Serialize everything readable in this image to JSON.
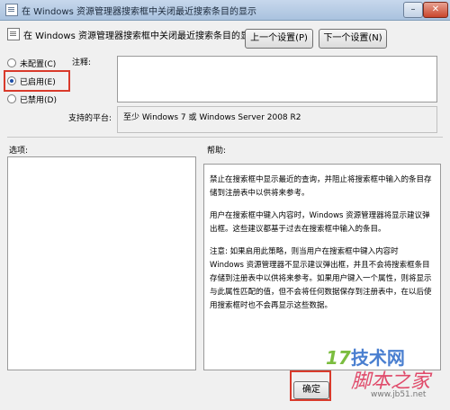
{
  "window": {
    "title": "在 Windows 资源管理器搜索框中关闭最近搜索条目的显示"
  },
  "setting": {
    "title": "在 Windows 资源管理器搜索框中关闭最近搜索条目的显示",
    "prev_label": "上一个设置(P)",
    "next_label": "下一个设置(N)"
  },
  "options": [
    {
      "label": "未配置(C)",
      "selected": false
    },
    {
      "label": "已启用(E)",
      "selected": true
    },
    {
      "label": "已禁用(D)",
      "selected": false
    }
  ],
  "comment_label": "注释:",
  "platform": {
    "label": "支持的平台:",
    "value": "至少 Windows 7 或 Windows Server 2008 R2"
  },
  "options_label": "选项:",
  "help_label": "帮助:",
  "help_paragraphs": [
    "禁止在搜索框中显示最近的查询，并阻止将搜索框中输入的条目存储到注册表中以供将来参考。",
    "用户在搜索框中键入内容时，Windows 资源管理器将显示建议弹出框。这些建议都基于过去在搜索框中输入的条目。",
    "注意: 如果启用此策略，则当用户在搜索框中键入内容时 Windows 资源管理器不显示建议弹出框，并且不会将搜索框条目存储到注册表中以供将来参考。如果用户键入一个属性，则将显示与此属性匹配的值，但不会将任何数据保存到注册表中，在以后使用搜索框时也不会再显示这些数据。"
  ],
  "ok_label": "确定",
  "watermark": {
    "site1": "技术网",
    "site1_prefix": "17",
    "site2": "脚本之家",
    "site2_url": "www.jb51.net"
  },
  "colors": {
    "highlight": "#d93a2b",
    "titlebar": "#b9cde4"
  },
  "icons": {
    "app": "policy-doc-icon",
    "setting": "policy-doc-icon",
    "close": "close-icon"
  }
}
